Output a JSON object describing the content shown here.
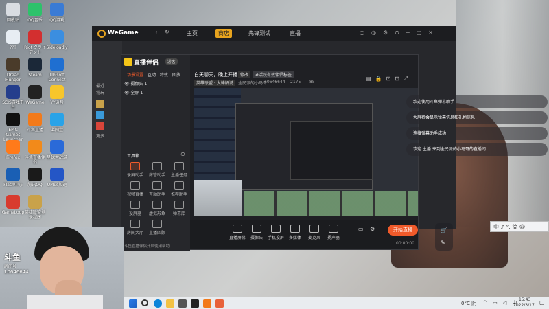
{
  "desktop_icons": [
    {
      "label": "回收站",
      "color": "#d9dde2"
    },
    {
      "label": "QQ音乐",
      "color": "#2ec26b"
    },
    {
      "label": "QQ游戏",
      "color": "#3a7bd5"
    },
    {
      "label": "???",
      "color": "#e7edf3"
    },
    {
      "label": "Riot クライアント",
      "color": "#d32f2f"
    },
    {
      "label": "Sideloadly",
      "color": "#3b8ee0"
    },
    {
      "label": "Dread Hunger",
      "color": "#4a3b2a"
    },
    {
      "label": "Steam",
      "color": "#1b2838"
    },
    {
      "label": "Ubisoft Connect",
      "color": "#1f6fd1"
    },
    {
      "label": "SCIS游戏平台",
      "color": "#243e8c"
    },
    {
      "label": "WeGame",
      "color": "#222222"
    },
    {
      "label": "YY语音",
      "color": "#f7c62b"
    },
    {
      "label": "EPIC Games Launcher",
      "color": "#111111"
    },
    {
      "label": "斗鱼直播",
      "color": "#f27a1a"
    },
    {
      "label": "上网宝",
      "color": "#29a3e8"
    },
    {
      "label": "Firefox",
      "color": "#ff7a1a"
    },
    {
      "label": "斗鱼直播伴侣",
      "color": "#f28a1a"
    },
    {
      "label": "星球大战游",
      "color": "#2a6ad8"
    },
    {
      "label": "Flash中心",
      "color": "#1a5fb4"
    },
    {
      "label": "腾讯QQ",
      "color": "#1a1a1a"
    },
    {
      "label": "UPlus加速",
      "color": "#2456c6"
    },
    {
      "label": "GameLoop",
      "color": "#d83b2f"
    },
    {
      "label": "英雄联盟登录程序",
      "color": "#c9a24a"
    }
  ],
  "wegame": {
    "brand": "WeGame",
    "nav": [
      "主页",
      "商店",
      "先锋测试",
      "直播"
    ],
    "active_tab": "商店",
    "left_label_1": "最近",
    "left_label_2": "常玩",
    "left_label_3": "更多"
  },
  "live": {
    "app_title": "直播伴侣",
    "badge": "游客",
    "scene_tabs": [
      "场景设置",
      "互动",
      "特效",
      "回放"
    ],
    "scenes": [
      "摄像头 1",
      "全屏 1"
    ],
    "title_line": "白天聊天，晚上开播！",
    "edit_label": "修改",
    "tag": "#活跃有效伴侣标签",
    "category": "英雄联盟 · 大神解说",
    "room_label": "全民派的小马哥",
    "room_id": "10646644",
    "fans": "2175",
    "extra": "85",
    "toolbox_label": "工具箱",
    "tools": [
      "录屏助手",
      "房管助手",
      "主播任务",
      "视频直播",
      "互动助手",
      "推荐助手",
      "投屏器",
      "虚拟形象",
      "弹幕库",
      "房间大厅",
      "直播回顾"
    ],
    "bottom_tools": [
      "直播屏幕",
      "摄像头",
      "手机投屏",
      "多媒体",
      "麦克风",
      "扬声器"
    ],
    "status_left": "斗鱼直播伴侣开启使用帮助",
    "status_right": "00:00:00",
    "start_button": "开始直播"
  },
  "notifications": [
    "欢迎使用斗鱼弹幕助手",
    "大屏将会显示弹幕信息和礼物信息",
    "连接弹幕助手成功",
    "欢迎 主播 来到全民派的小马哥的直播间"
  ],
  "streamer": {
    "platform": "斗鱼",
    "room_label": "房间号",
    "room_id": "10646644"
  },
  "ime": {
    "text": "中 ♪ °, 简 ☺"
  },
  "taskbar": {
    "weather": "0°C 阴",
    "time": "15:43",
    "date": "2022/3/17"
  }
}
